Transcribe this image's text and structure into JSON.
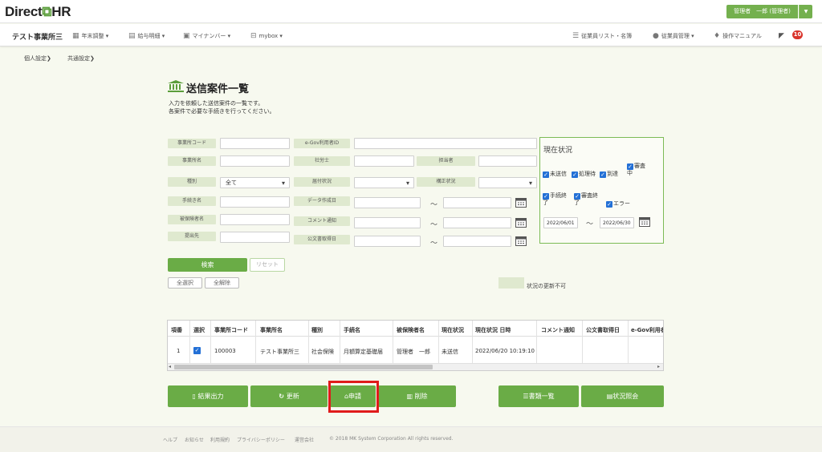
{
  "app": {
    "logo_left": "Direct",
    "logo_right": "HR",
    "user_label": "管理者　一郎 (管理者)"
  },
  "nav": {
    "office": "テスト事業所三",
    "left": [
      "年末調整 ▾",
      "給与明細 ▾",
      "マイナンバー ▾",
      "mybox ▾"
    ],
    "right": [
      "従業員リスト・名簿",
      "従業員管理 ▾",
      "操作マニュアル"
    ],
    "notification_count": "10"
  },
  "subnav": [
    "個人設定",
    "共通設定"
  ],
  "page": {
    "title": "送信案件一覧",
    "desc1": "入力を依頼した送信案件の一覧です。",
    "desc2": "各案件で必要な手続きを行ってください。"
  },
  "form": {
    "labels": {
      "office_code": "事業所コード",
      "egov_id": "e-Gov利用者ID",
      "office_name": "事業所名",
      "sharoshi": "社労士",
      "tantou": "担当者",
      "kind": "種別",
      "todoke": "届付状況",
      "seisei": "構正状況",
      "tetsuzuki": "手続き名",
      "data_date": "データ作成日",
      "hihoken": "被保険者名",
      "comment": "コメント通知",
      "teishutsu": "提出先",
      "kobun": "公文書取得日"
    },
    "kind_value": "全て",
    "tilde": "～"
  },
  "status": {
    "title": "現在状況",
    "checks": [
      "未送信",
      "処理待",
      "到達",
      "審査中",
      "手続終了",
      "審査終了",
      "エラー"
    ],
    "from": "2022/06/01",
    "to": "2022/06/30"
  },
  "buttons": {
    "search": "検索",
    "reset": "リセット",
    "select_all": "全選択",
    "deselect_all": "全解除"
  },
  "legend": {
    "text": "状況の更新不可",
    "color": "#dfe9cf"
  },
  "table": {
    "headers": [
      "項番",
      "選択",
      "事業所コード",
      "事業所名",
      "種別",
      "手続名",
      "被保険者名",
      "現在状況",
      "現在状況 日時",
      "コメント通知",
      "公文書取得日",
      "e-Gov利用者"
    ],
    "rows": [
      {
        "no": "1",
        "checked": "✓",
        "office_code": "100003",
        "office_name": "テスト事業所三",
        "kind": "社会保険",
        "procedure": "月額算定基礎届",
        "insured": "管理者　一郎",
        "status": "未送信",
        "status_time": "2022/06/20 10:19:10"
      }
    ]
  },
  "actions": {
    "export": "結果出力",
    "refresh": "更新",
    "apply": "申請",
    "delete": "削除",
    "docs": "書類一覧",
    "inquiry": "状況照会"
  },
  "footer": {
    "links": [
      "ヘルプ",
      "お知らせ",
      "利用規約",
      "プライバシーポリシー",
      "運営会社"
    ],
    "copyright": "© 2018 MK System Corporation All rights reserved."
  },
  "colors": {
    "brand": "#6aac46",
    "highlight": "#e01b1b",
    "badge": "#d9342b"
  }
}
